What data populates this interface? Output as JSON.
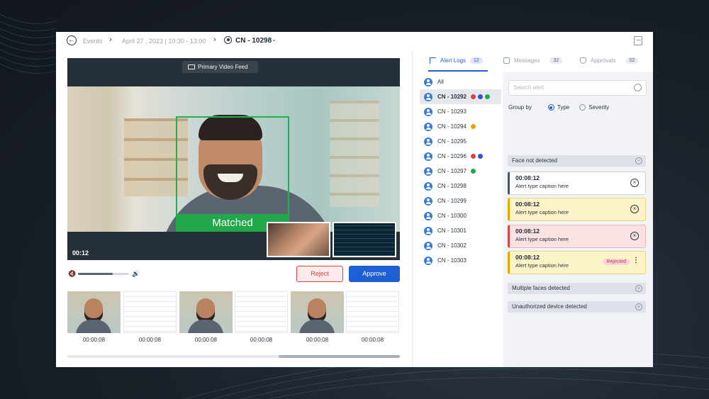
{
  "colors": {
    "accent": "#1f5fd6",
    "matched": "#21a84a",
    "reject": "#d64545"
  },
  "header": {
    "back_icon": "arrow-left-icon",
    "events": "Events",
    "datetime": "April 27 , 2023 | 10:30 - 13:00",
    "candidate": "CN - 10298",
    "exit_icon": "exit-icon"
  },
  "video": {
    "feed_label": "Primary Video Feed",
    "match_label": "Matched",
    "timestamp": "00:12",
    "volume_level": 0.68
  },
  "actions": {
    "reject": "Reject",
    "approve": "Approve"
  },
  "thumbnails": [
    {
      "kind": "face",
      "time": "00:00:08"
    },
    {
      "kind": "doc",
      "time": "00:00:08"
    },
    {
      "kind": "face",
      "time": "00:00:08"
    },
    {
      "kind": "doc",
      "time": "00:00:08"
    },
    {
      "kind": "face",
      "time": "00:00:08"
    },
    {
      "kind": "doc",
      "time": "00:00:08"
    }
  ],
  "tabs": [
    {
      "label": "Alert Logs",
      "count": "12",
      "icon": "flag-icon",
      "active": true
    },
    {
      "label": "Messages",
      "count": "32",
      "icon": "message-icon",
      "active": false
    },
    {
      "label": "Approvals",
      "count": "02",
      "icon": "shield-icon",
      "active": false
    }
  ],
  "candidates": [
    {
      "label": "All",
      "dots": []
    },
    {
      "label": "CN - 10292",
      "selected": true,
      "dots": [
        "#d64545",
        "#3a4fd5",
        "#21a84a"
      ]
    },
    {
      "label": "CN - 10293",
      "dots": []
    },
    {
      "label": "CN - 10294",
      "dots": [
        "#e2a800"
      ]
    },
    {
      "label": "CN - 10295",
      "dots": []
    },
    {
      "label": "CN - 10296",
      "dots": [
        "#d64545",
        "#3a4fd5"
      ]
    },
    {
      "label": "CN - 10297",
      "dots": [
        "#21a84a"
      ]
    },
    {
      "label": "CN - 10298",
      "dots": []
    },
    {
      "label": "CN - 10299",
      "dots": []
    },
    {
      "label": "CN - 10300",
      "dots": []
    },
    {
      "label": "CN - 10301",
      "dots": []
    },
    {
      "label": "CN - 10302",
      "dots": []
    },
    {
      "label": "CN - 10303",
      "dots": []
    }
  ],
  "alerts": {
    "search_placeholder": "Search alert",
    "group_by": "Group by",
    "options": [
      "Type",
      "Severity"
    ],
    "selected_option": "Type",
    "sections": [
      {
        "title": "Face not detected",
        "expanded": true
      },
      {
        "title": "Multiple faces detected",
        "expanded": false
      },
      {
        "title": "Unauthorized device detected",
        "expanded": false
      }
    ],
    "cards": [
      {
        "time": "00:08:12",
        "caption": "Alert type caption here",
        "color": "grey",
        "action": "close"
      },
      {
        "time": "00:08:12",
        "caption": "Alert type caption here",
        "color": "yellow",
        "action": "close"
      },
      {
        "time": "00:08:12",
        "caption": "Alert type caption here",
        "color": "red",
        "action": "close"
      },
      {
        "time": "00:08:12",
        "caption": "Alert type caption here",
        "color": "yellow",
        "action": "menu",
        "badge": "Rejected"
      }
    ]
  }
}
